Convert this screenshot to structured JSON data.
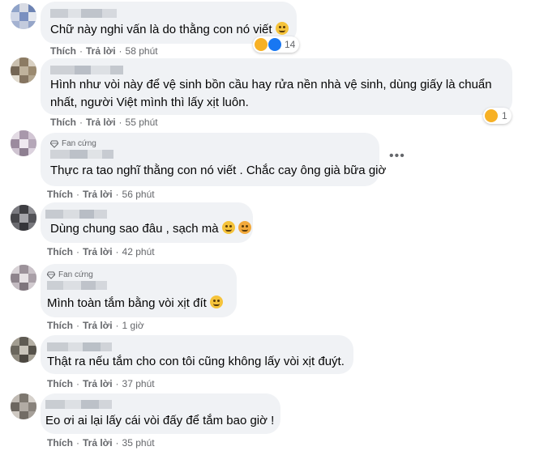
{
  "labels": {
    "like": "Thích",
    "reply": "Trả lời",
    "dot": "·",
    "fan_badge": "Fan cứng",
    "more": "•••"
  },
  "comments": [
    {
      "text": [
        "Chữ này nghi vấn là do thằng con nó viết"
      ],
      "time": "58 phút",
      "reaction_count": "14",
      "fan": false
    },
    {
      "text": [
        "Hình như vòi này để vệ sinh bồn cầu hay rửa nền nhà vệ sinh, dùng giấy là chuẩn",
        "nhất, người Việt mình thì lấy xịt luôn."
      ],
      "time": "55 phút",
      "reaction_count": "1",
      "fan": false
    },
    {
      "text": [
        "Thực ra tao nghĩ thằng con nó viết . Chắc cay ông già bữa giờ"
      ],
      "time": "56 phút",
      "fan": true
    },
    {
      "text": [
        "Dùng chung sao đâu , sạch mà"
      ],
      "time": "42 phút",
      "fan": false
    },
    {
      "text": [
        "Mình toàn tắm bằng vòi xịt đít"
      ],
      "time": "1 giờ",
      "fan": true
    },
    {
      "text": [
        "Thật ra nếu tắm cho con tôi cũng không lấy vòi xịt đuýt."
      ],
      "time": "37 phút",
      "fan": false
    },
    {
      "text": [
        "Eo ơi ai lại lấy cái vòi đấy để tắm bao giờ !"
      ],
      "time": "35 phút",
      "fan": false
    }
  ],
  "icons": {
    "reaction_haha": "haha-icon",
    "reaction_like": "like-icon",
    "emoji_wink": "smile-emoji",
    "diamond": "diamond-icon",
    "more": "more-options-icon"
  },
  "colors": {
    "bubble": "#f0f2f5",
    "meta_text": "#65676b",
    "like_blue": "#1877f2",
    "haha_yellow": "#f7b125"
  }
}
